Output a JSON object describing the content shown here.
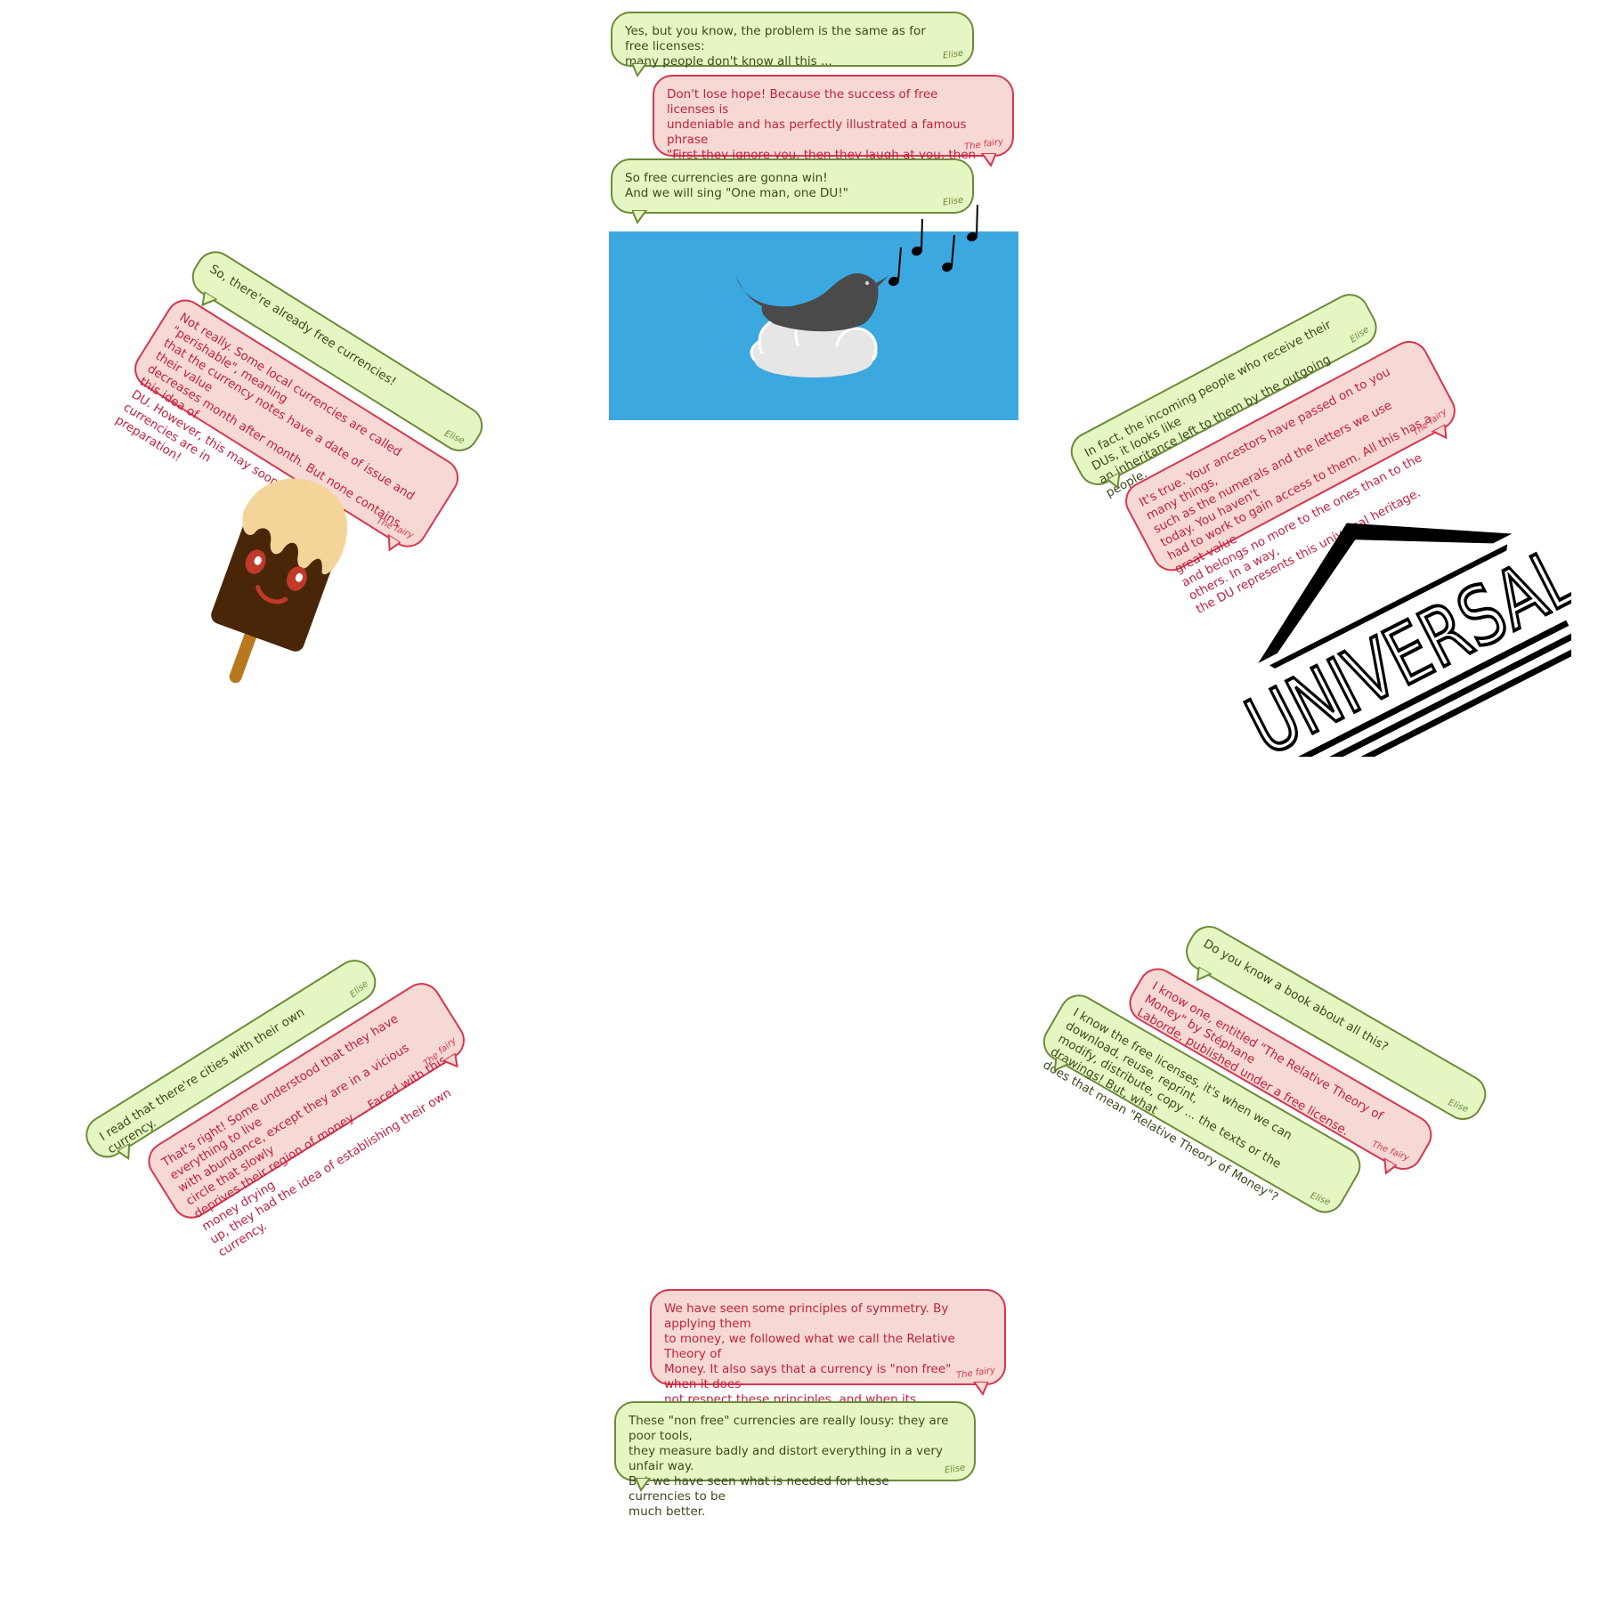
{
  "speakers": {
    "elise": "Elise",
    "fairy": "The fairy"
  },
  "colors": {
    "elise_bubble": "#e4f7c2",
    "elise_border": "#6d8a3a",
    "fairy_bubble": "#f6d9d4",
    "fairy_border": "#d6364f",
    "sky": "#3ba8df",
    "bird": "#4a4a4a"
  },
  "top": {
    "b1": "Yes, but you know, the problem is the same as for free licenses:\nmany people don't know all this ...",
    "b2": "Don't lose hope! Because the success of free licenses is\nundeniable and has perfectly illustrated a famous phrase\n\"First they ignore you, then they laugh at you, then they\nfight you, then you win.\"",
    "b3": "So free currencies are gonna win!\nAnd we will sing \"One man, one DU!\""
  },
  "upper_left": {
    "b1": "So, there're already free currencies!",
    "b2": "Not really. Some local currencies are called \"perishable\", meaning\nthat the currency notes have a date of issue and their value\ndecreases month after month. But none contains this idea of\nDU. However, this may soon change: free currencies are in\npreparation!"
  },
  "upper_right": {
    "b1": "In fact, the incoming people who receive their DUs, it looks like\nan inheritance left to them by the outgoing people.",
    "b2": "It's true. Your ancestors have passed on to you many things,\nsuch as the numerals and the letters we use today. You haven't\nhad to work to gain access to them. All this has a great value\nand belongs no more to the ones than to the others. In a way,\nthe DU represents this universal heritage.",
    "logo_text": "UNIVERSAL"
  },
  "lower_left": {
    "b1": "I read that there're cities with their own currency.",
    "b2": "That's right! Some understood that they have everything to live\nwith abundance, except they are in a vicious circle that slowly\ndeprives their region of money ... Faced with this money drying\nup, they had the idea of establishing their own currency."
  },
  "lower_right": {
    "b1": "Do you know a book about all this?",
    "b2": "I know one, entitled \"The Relative Theory of Money\" by Stéphane\nLaborde, published under a free license.",
    "b3": "I know the free licenses, it's when we can download, reuse, reprint,\nmodify, distribute, copy ... the texts or the drawings! But, what\ndoes that mean \"Relative Theory of Money\"?"
  },
  "bottom": {
    "b1": "We have seen some principles of symmetry. By applying them\nto money, we followed what we call the Relative Theory of\nMoney. It also says that a currency is \"non free\" when it does\nnot respect these principles, and when its functioning is not\naccessible to all.",
    "b2": "These \"non free\" currencies are really lousy: they are poor tools,\nthey measure badly and distort everything in a very unfair way.\nBut we have seen what is needed for these currencies to be\nmuch better."
  }
}
